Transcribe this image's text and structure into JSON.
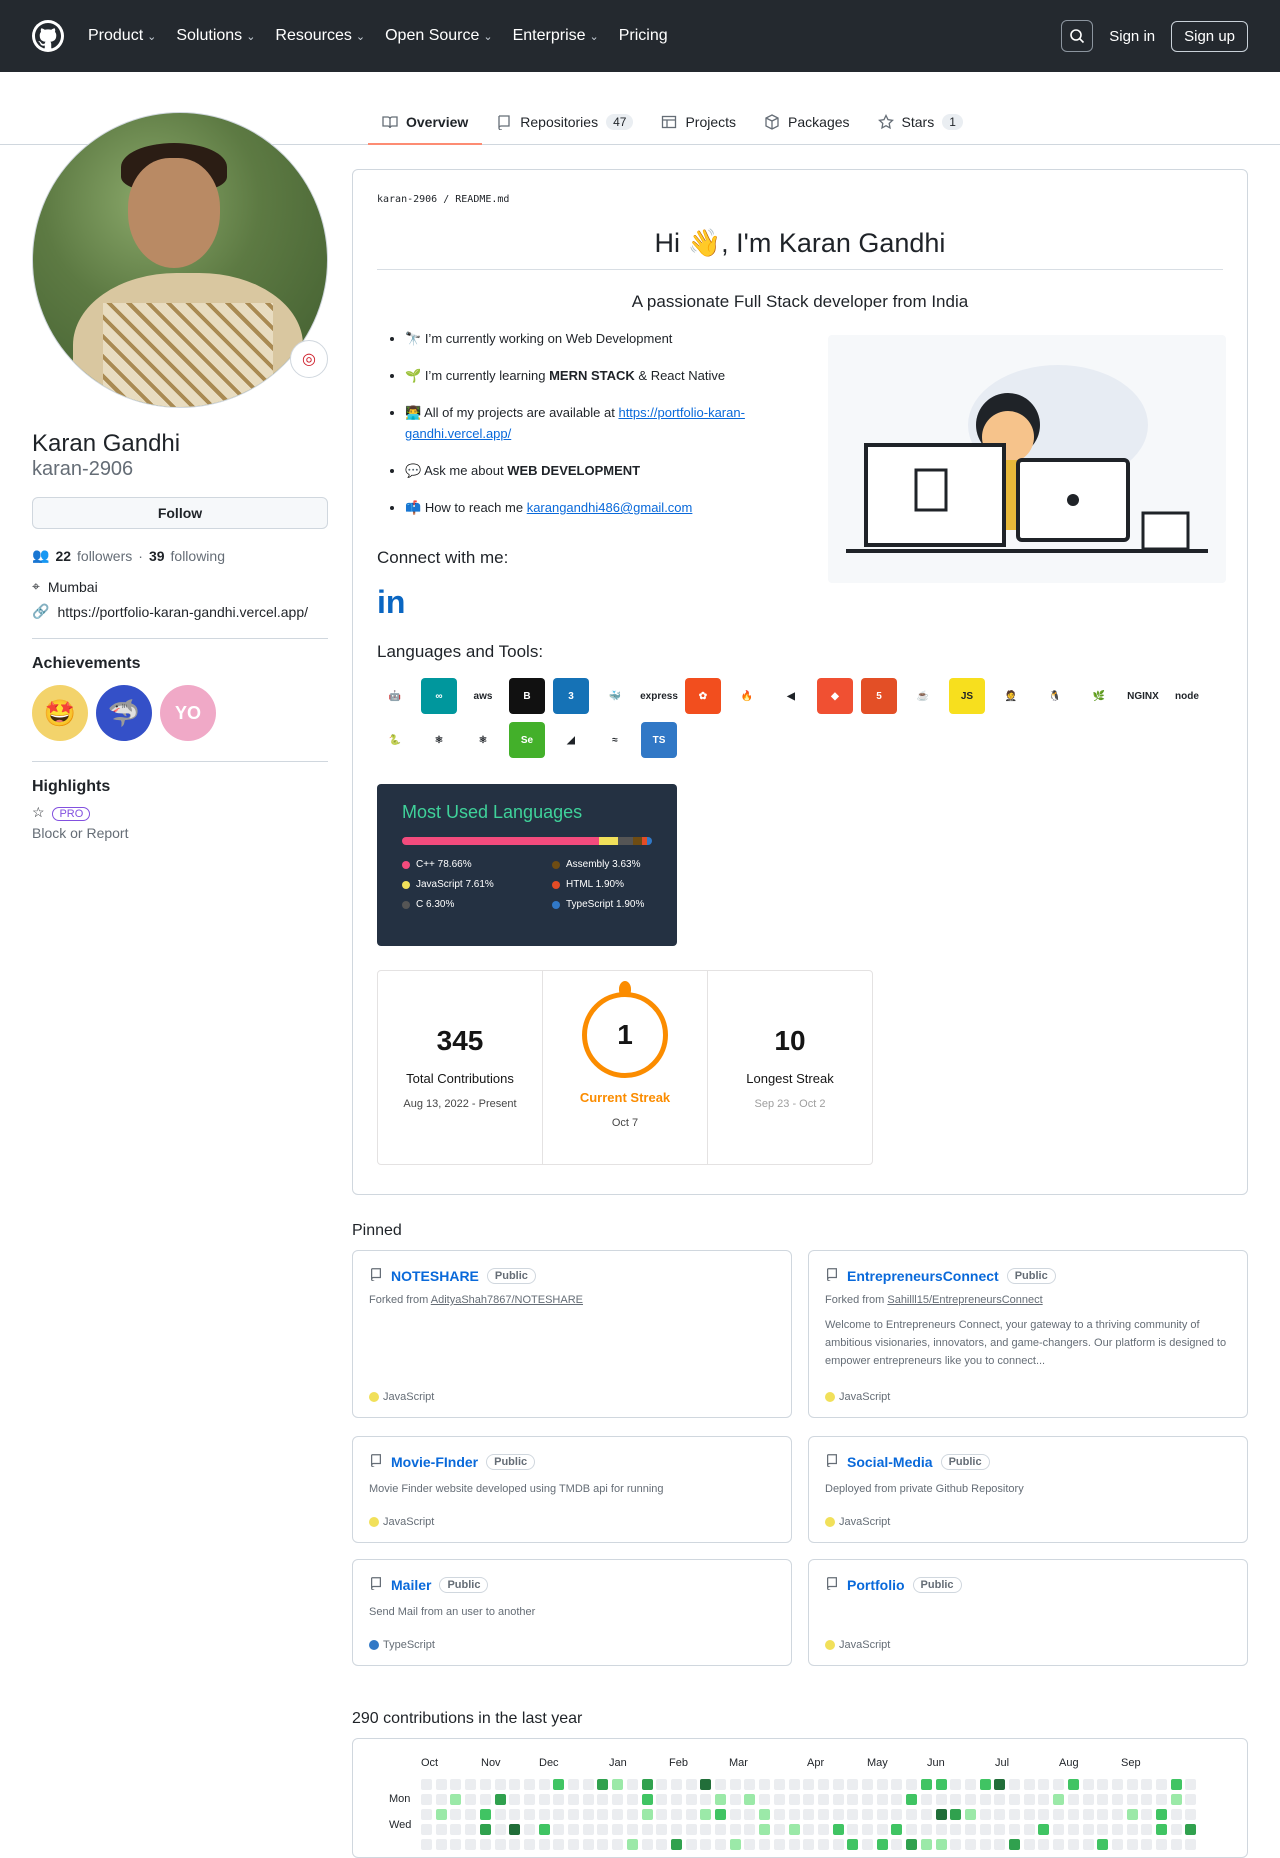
{
  "header": {
    "nav": [
      {
        "label": "Product",
        "chev": true
      },
      {
        "label": "Solutions",
        "chev": true
      },
      {
        "label": "Resources",
        "chev": true
      },
      {
        "label": "Open Source",
        "chev": true
      },
      {
        "label": "Enterprise",
        "chev": true
      },
      {
        "label": "Pricing",
        "chev": false
      }
    ],
    "signin": "Sign in",
    "signup": "Sign up"
  },
  "tabs": [
    {
      "label": "Overview",
      "count": null,
      "icon": "book-icon"
    },
    {
      "label": "Repositories",
      "count": "47",
      "icon": "repo-icon"
    },
    {
      "label": "Projects",
      "count": null,
      "icon": "table-icon"
    },
    {
      "label": "Packages",
      "count": null,
      "icon": "package-icon"
    },
    {
      "label": "Stars",
      "count": "1",
      "icon": "star-icon"
    }
  ],
  "profile": {
    "name": "Karan Gandhi",
    "username": "karan-2906",
    "follow": "Follow",
    "followers": "22",
    "followers_lbl": "followers",
    "following": "39",
    "following_lbl": "following",
    "location": "Mumbai",
    "website": "https://portfolio-karan-gandhi.vercel.app/",
    "achievements_h": "Achievements",
    "highlights_h": "Highlights",
    "pro": "PRO",
    "block": "Block or Report"
  },
  "readme": {
    "crumb": "karan-2906 / README.md",
    "hi": "Hi 👋, I'm Karan Gandhi",
    "sub": "A passionate Full Stack developer from India",
    "bullets": [
      {
        "emoji": "🔭",
        "pre": "I’m currently working on ",
        "bold": "",
        "post": "Web Development",
        "link": ""
      },
      {
        "emoji": "🌱",
        "pre": "I’m currently learning ",
        "bold": "MERN STACK",
        "post": " & React Native",
        "link": ""
      },
      {
        "emoji": "👨‍💻",
        "pre": "All of my projects are available at ",
        "bold": "",
        "post": "",
        "link": "https://portfolio-karan-gandhi.vercel.app/"
      },
      {
        "emoji": "💬",
        "pre": "Ask me about ",
        "bold": "WEB DEVELOPMENT",
        "post": "",
        "link": ""
      },
      {
        "emoji": "📫",
        "pre": "How to reach me ",
        "bold": "",
        "post": "",
        "link": "karangandhi486@gmail.com"
      }
    ],
    "connect": "Connect with me:",
    "linkedin": "in",
    "languages_tools": "Languages and Tools:",
    "tools": [
      {
        "t": "🤖",
        "c": "#ffffff"
      },
      {
        "t": "∞",
        "c": "#00979d"
      },
      {
        "t": "aws",
        "c": "#ffffff"
      },
      {
        "t": "B",
        "c": "#111111"
      },
      {
        "t": "3",
        "c": "#1572b6"
      },
      {
        "t": "🐳",
        "c": "#ffffff"
      },
      {
        "t": "express",
        "c": "#ffffff"
      },
      {
        "t": "✿",
        "c": "#f24e1e"
      },
      {
        "t": "🔥",
        "c": "#ffffff"
      },
      {
        "t": "◀",
        "c": "#ffffff"
      },
      {
        "t": "◆",
        "c": "#f05032"
      },
      {
        "t": "5",
        "c": "#e34f26"
      },
      {
        "t": "☕",
        "c": "#ffffff"
      },
      {
        "t": "JS",
        "c": "#f7df1e"
      },
      {
        "t": "🤵",
        "c": "#ffffff"
      },
      {
        "t": "🐧",
        "c": "#ffffff"
      },
      {
        "t": "🌿",
        "c": "#ffffff"
      },
      {
        "t": "NGINX",
        "c": "#ffffff"
      },
      {
        "t": "node",
        "c": "#ffffff"
      },
      {
        "t": "🐍",
        "c": "#ffffff"
      },
      {
        "t": "⚛",
        "c": "#ffffff"
      },
      {
        "t": "⚛",
        "c": "#ffffff"
      },
      {
        "t": "Se",
        "c": "#43b02a"
      },
      {
        "t": "◢",
        "c": "#ffffff"
      },
      {
        "t": "≈",
        "c": "#ffffff"
      },
      {
        "t": "TS",
        "c": "#3178c6"
      }
    ],
    "most_used": {
      "title": "Most Used Languages",
      "items": [
        {
          "name": "C++ 78.66%",
          "pct": 78.66,
          "color": "#f34b7d"
        },
        {
          "name": "Assembly 3.63%",
          "pct": 3.63,
          "color": "#6e4c13"
        },
        {
          "name": "JavaScript 7.61%",
          "pct": 7.61,
          "color": "#f1e05a"
        },
        {
          "name": "HTML 1.90%",
          "pct": 1.9,
          "color": "#e34c26"
        },
        {
          "name": "C 6.30%",
          "pct": 6.3,
          "color": "#555555"
        },
        {
          "name": "TypeScript 1.90%",
          "pct": 1.9,
          "color": "#3178c6"
        }
      ]
    },
    "streak": {
      "total": "345",
      "total_lbl": "Total Contributions",
      "total_date": "Aug 13, 2022 - Present",
      "current": "1",
      "current_lbl": "Current Streak",
      "current_date": "Oct 7",
      "longest": "10",
      "longest_lbl": "Longest Streak",
      "longest_date": "Sep 23 - Oct 2"
    }
  },
  "pinned": {
    "title": "Pinned",
    "items": [
      {
        "name": "NOTESHARE",
        "vis": "Public",
        "fork_pre": "Forked from ",
        "fork": "AdityaShah7867/NOTESHARE",
        "desc": "",
        "lang": "JavaScript",
        "lang_color": "#f1e05a"
      },
      {
        "name": "EntrepreneursConnect",
        "vis": "Public",
        "fork_pre": "Forked from ",
        "fork": "Sahilll15/EntrepreneursConnect",
        "desc": "Welcome to Entrepreneurs Connect, your gateway to a thriving community of ambitious visionaries, innovators, and game-changers. Our platform is designed to empower entrepreneurs like you to connect...",
        "lang": "JavaScript",
        "lang_color": "#f1e05a"
      },
      {
        "name": "Movie-FInder",
        "vis": "Public",
        "fork_pre": "",
        "fork": "",
        "desc": "Movie Finder website developed using TMDB api for running",
        "lang": "JavaScript",
        "lang_color": "#f1e05a"
      },
      {
        "name": "Social-Media",
        "vis": "Public",
        "fork_pre": "",
        "fork": "",
        "desc": "Deployed from private Github Repository",
        "lang": "JavaScript",
        "lang_color": "#f1e05a"
      },
      {
        "name": "Mailer",
        "vis": "Public",
        "fork_pre": "",
        "fork": "",
        "desc": "Send Mail from an user to another",
        "lang": "TypeScript",
        "lang_color": "#3178c6"
      },
      {
        "name": "Portfolio",
        "vis": "Public",
        "fork_pre": "",
        "fork": "",
        "desc": "",
        "lang": "JavaScript",
        "lang_color": "#f1e05a"
      }
    ]
  },
  "contributions": {
    "title": "290 contributions in the last year",
    "months": [
      "Oct",
      "Nov",
      "Dec",
      "Jan",
      "Feb",
      "Mar",
      "Apr",
      "May",
      "Jun",
      "Jul",
      "Aug",
      "Sep"
    ],
    "days": [
      "Mon",
      "Wed"
    ]
  }
}
